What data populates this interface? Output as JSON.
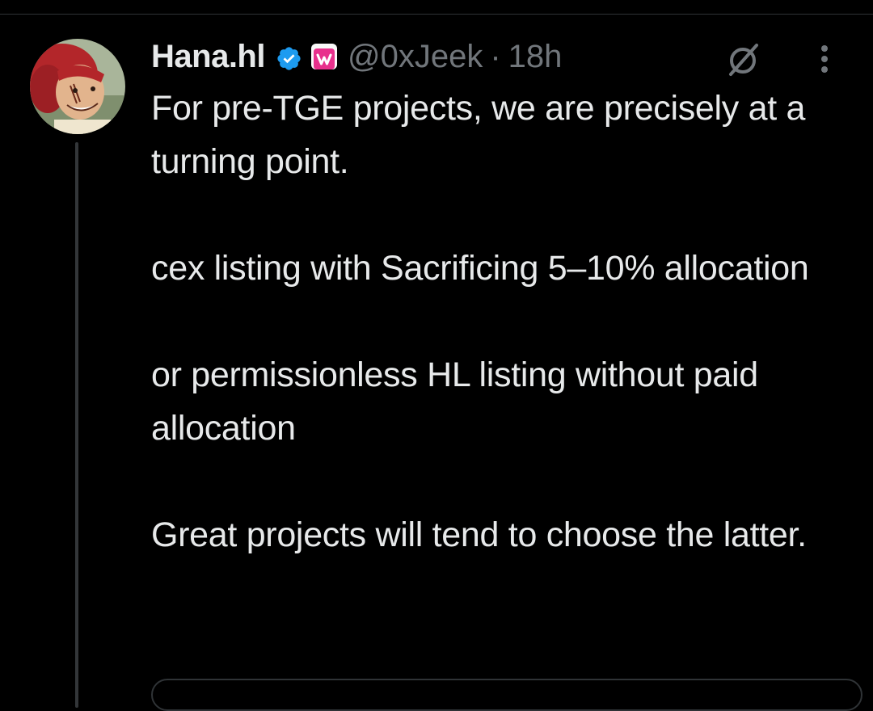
{
  "tweet": {
    "author": {
      "display_name": "Hana.hl",
      "handle": "@0xJeek",
      "verified": true,
      "avatar_icon": "anime-character-avatar"
    },
    "separator": "·",
    "timestamp": "18h",
    "paragraphs": [
      "For pre-TGE projects, we are precisely at a turning point.",
      "cex listing with Sacrificing 5–10% allocation",
      "or permissionless HL listing without paid allocation",
      "Great projects will tend to choose the latter."
    ]
  },
  "icons": {
    "verified": "verified-badge-icon",
    "affiliate": "affiliate-badge-icon",
    "grok": "grok-icon",
    "more": "more-vertical-icon"
  },
  "colors": {
    "background": "#000000",
    "text_primary": "#e7e9ea",
    "text_secondary": "#71767b",
    "verified_blue": "#1d9bf0",
    "affiliate_pink": "#e8308c"
  }
}
